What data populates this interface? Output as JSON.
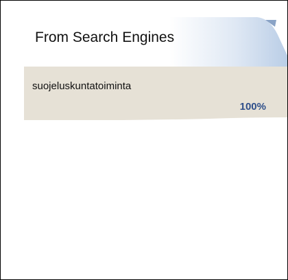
{
  "widget": {
    "title": "From Search Engines",
    "keywords": [
      {
        "term": "suojeluskuntatoiminta",
        "percent": "100%"
      }
    ],
    "colors": {
      "header_gradient_start": "#ffffff",
      "header_gradient_end": "#b9cde6",
      "row_background": "#e6e1d6",
      "percent_text": "#2f4f8a"
    }
  }
}
